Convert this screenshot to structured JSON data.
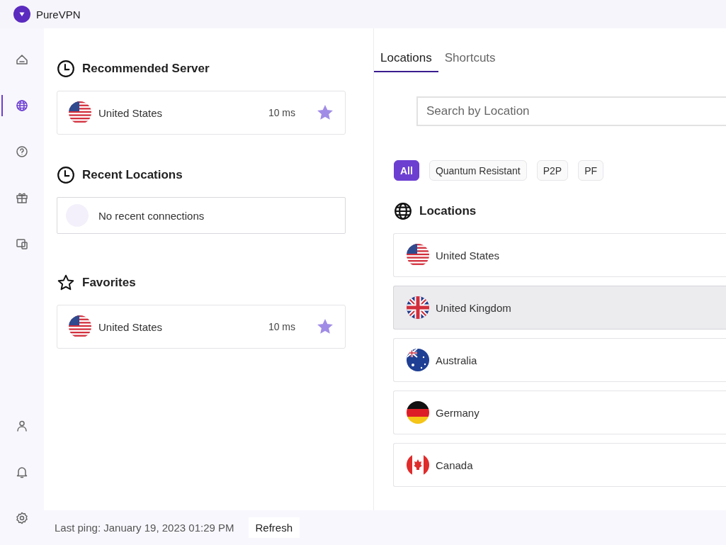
{
  "window": {
    "title": "PureVPN"
  },
  "sidebar": {
    "items": [
      {
        "kind": "home",
        "selected": false
      },
      {
        "kind": "globe",
        "selected": true
      },
      {
        "kind": "help",
        "selected": false
      },
      {
        "kind": "gift",
        "selected": false
      },
      {
        "kind": "devices",
        "selected": false
      }
    ],
    "bottom_items": [
      {
        "kind": "user"
      },
      {
        "kind": "bell"
      },
      {
        "kind": "settings"
      }
    ]
  },
  "recommended": {
    "title": "Recommended Server",
    "servers": [
      {
        "name": "United States",
        "kind": "us",
        "ping": "10 ms",
        "favorite": true
      }
    ]
  },
  "recent": {
    "title": "Recent Locations",
    "empty_text": "No recent connections"
  },
  "favorites": {
    "title": "Favorites",
    "servers": [
      {
        "name": "United States",
        "kind": "us",
        "ping": "10 ms",
        "favorite": true
      }
    ]
  },
  "tabs": [
    {
      "label": "Locations",
      "selected": true
    },
    {
      "label": "Shortcuts",
      "selected": false
    }
  ],
  "search": {
    "placeholder": "Search by Location"
  },
  "filters": [
    {
      "label": "All",
      "selected": true
    },
    {
      "label": "Quantum Resistant",
      "selected": false
    },
    {
      "label": "P2P",
      "selected": false
    },
    {
      "label": "PF",
      "selected": false
    }
  ],
  "locations": {
    "title": "Locations",
    "items": [
      {
        "name": "United States",
        "kind": "us",
        "hovered": false
      },
      {
        "name": "United Kingdom",
        "kind": "uk",
        "hovered": true
      },
      {
        "name": "Australia",
        "kind": "au",
        "hovered": false
      },
      {
        "name": "Germany",
        "kind": "de",
        "hovered": false
      },
      {
        "name": "Canada",
        "kind": "ca",
        "hovered": false
      }
    ]
  },
  "status_bar": {
    "last_ping": "Last ping: January 19, 2023 01:29 PM",
    "refresh": "Refresh"
  }
}
